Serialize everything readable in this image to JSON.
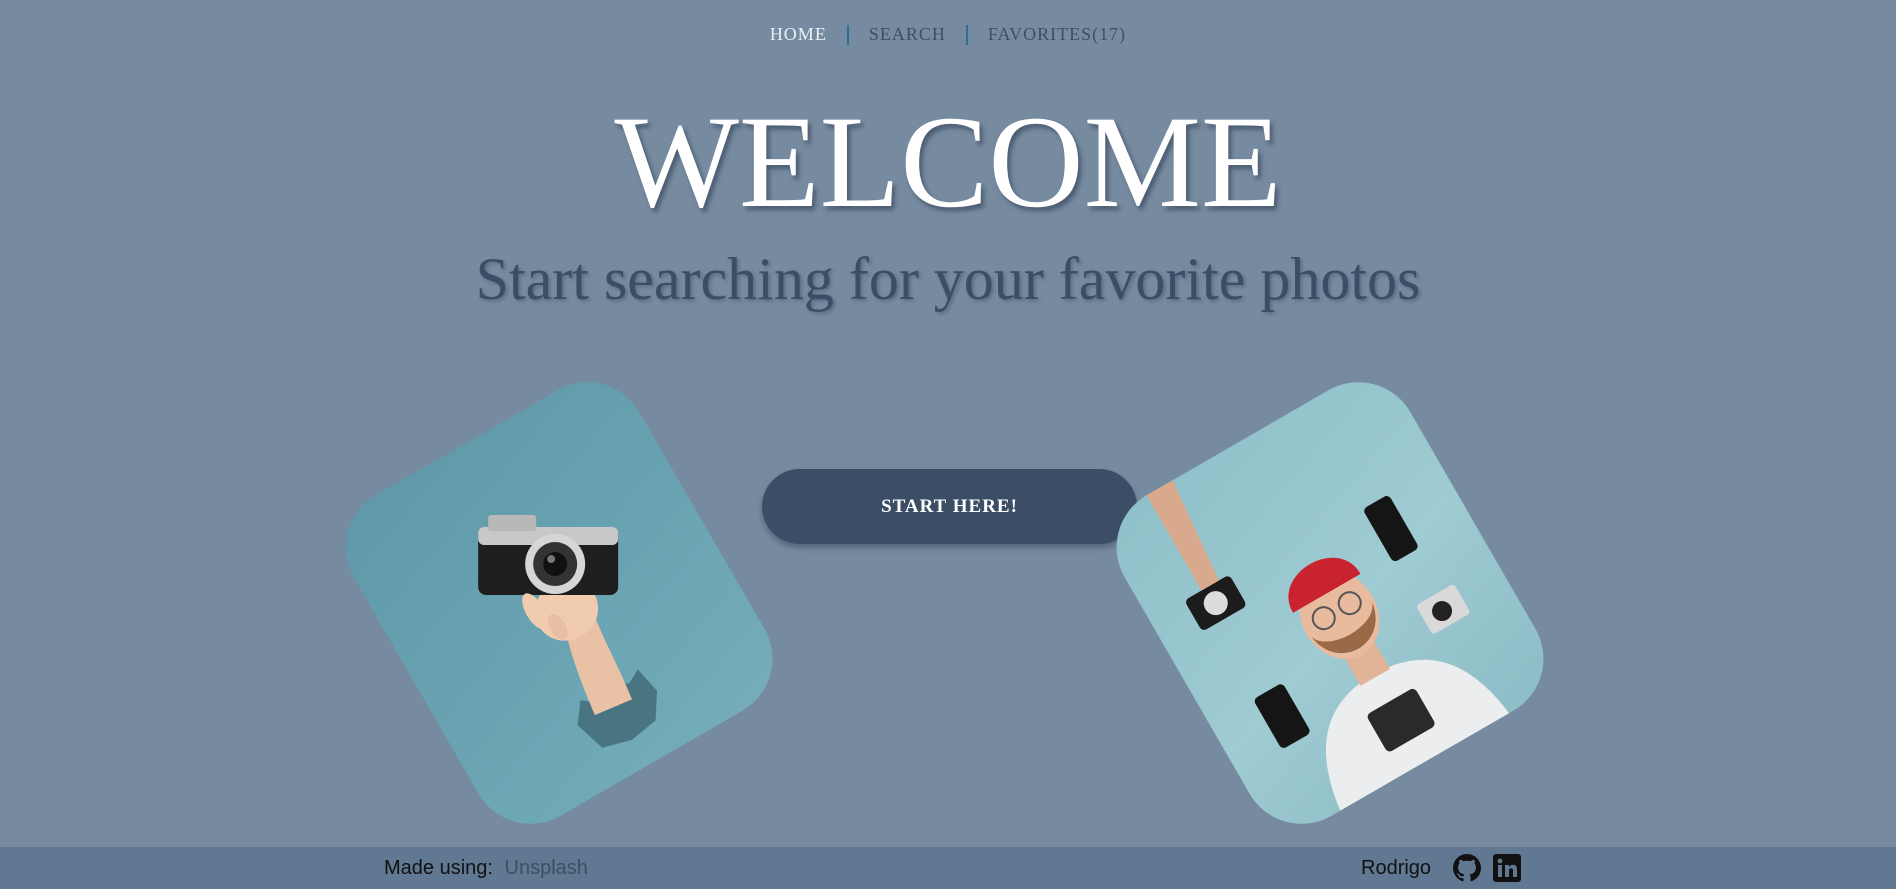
{
  "nav": {
    "items": [
      {
        "label": "HOME",
        "active": true
      },
      {
        "label": "SEARCH",
        "active": false
      },
      {
        "label": "FAVORITES(17)",
        "active": false
      }
    ]
  },
  "hero": {
    "title": "WELCOME",
    "subtitle": "Start searching for your favorite photos"
  },
  "cta": {
    "label": "START HERE!"
  },
  "images": {
    "left": "hand-holding-camera-photo",
    "right": "man-surrounded-by-cameras-photo"
  },
  "footer": {
    "made_using_label": "Made using:",
    "made_using_link": "Unsplash",
    "author": "Rodrigo",
    "icons": [
      "github-icon",
      "linkedin-icon"
    ]
  },
  "colors": {
    "background": "#768aa0",
    "accent": "#3b4e66",
    "footer": "#617892",
    "nav_active": "#e8f1f8",
    "separator": "#2f6f93"
  }
}
